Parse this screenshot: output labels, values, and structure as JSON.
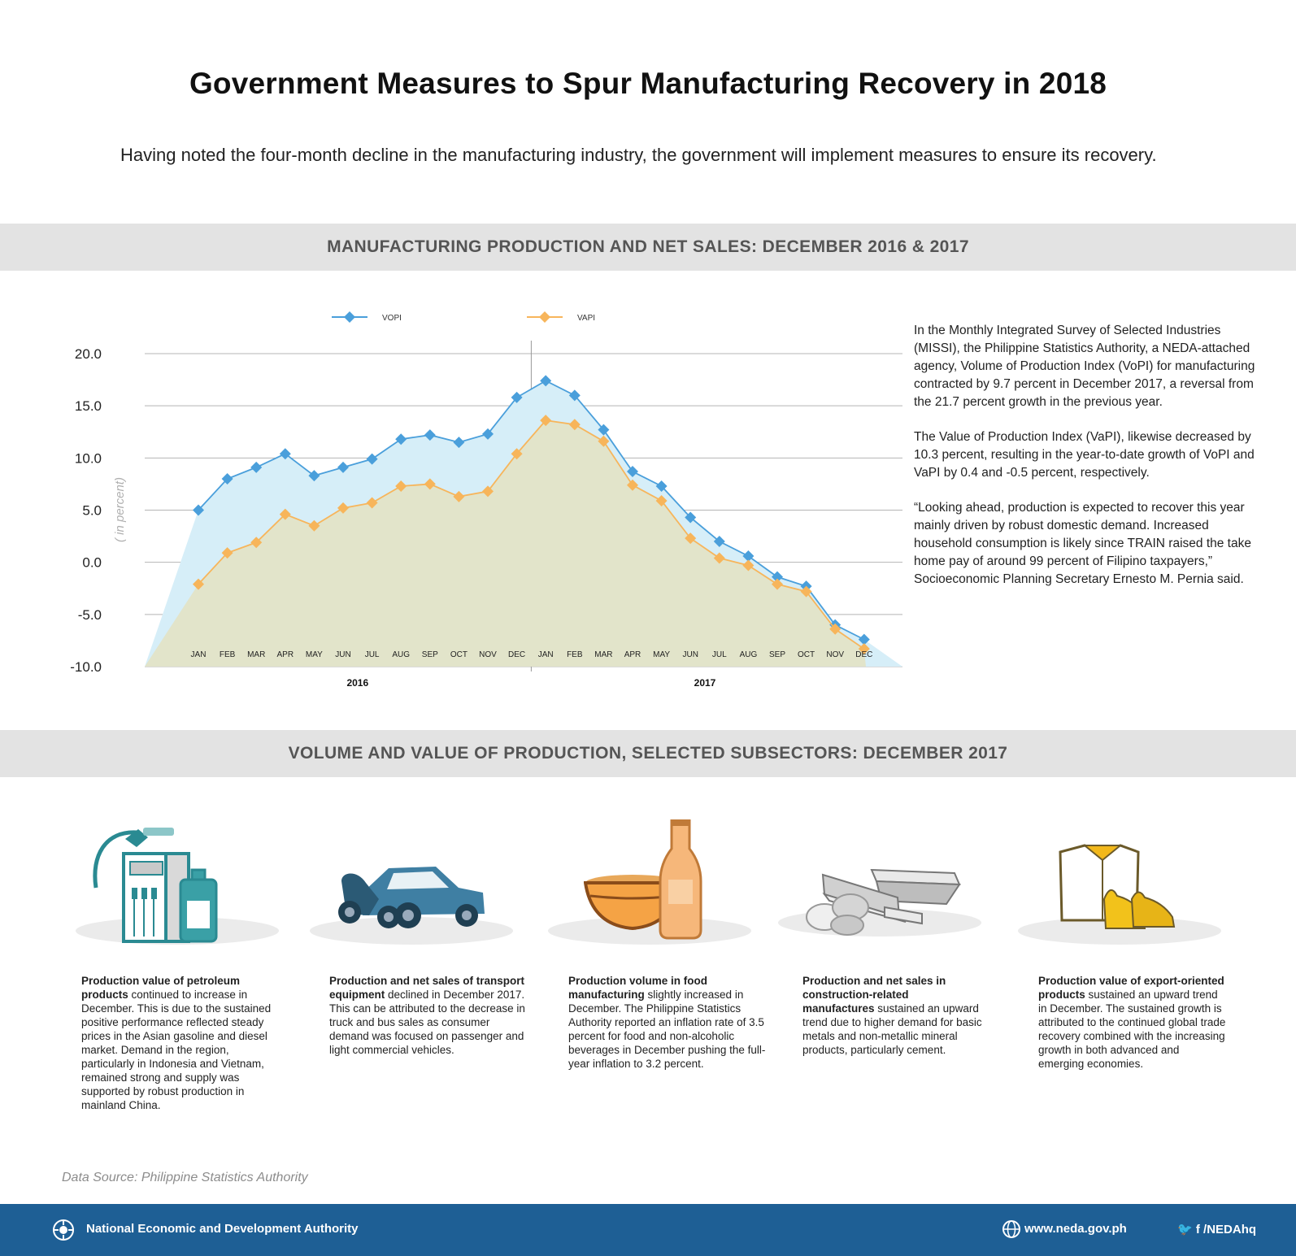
{
  "title": "Government Measures to Spur Manufacturing Recovery in 2018",
  "intro": "Having noted the four-month decline in the manufacturing industry, the government will implement measures to ensure its recovery.",
  "section1_title": "MANUFACTURING PRODUCTION AND NET SALES: DECEMBER 2016 & 2017",
  "section2_title": "VOLUME AND VALUE OF PRODUCTION, SELECTED SUBSECTORS: DECEMBER 2017",
  "chart_data": {
    "type": "area",
    "ylabel": "( in percent)",
    "ylim": [
      -10,
      20
    ],
    "yticks": [
      "20.0",
      "15.0",
      "10.0",
      "5.0",
      "0.0",
      "-5.0",
      "-10.0"
    ],
    "categories": [
      "JAN",
      "FEB",
      "MAR",
      "APR",
      "MAY",
      "JUN",
      "JUL",
      "AUG",
      "SEP",
      "OCT",
      "NOV",
      "DEC",
      "JAN",
      "FEB",
      "MAR",
      "APR",
      "MAY",
      "JUN",
      "JUL",
      "AUG",
      "SEP",
      "OCT",
      "NOV",
      "DEC"
    ],
    "year_groups": [
      "2016",
      "2017"
    ],
    "grid": true,
    "legend": "top",
    "series": [
      {
        "name": "VOPI",
        "color": "#4a9fdb",
        "fill": "#d6eef8",
        "values": [
          5.0,
          8.0,
          9.1,
          10.4,
          8.3,
          9.1,
          9.9,
          11.8,
          12.2,
          11.5,
          12.3,
          15.8,
          17.4,
          16.0,
          12.7,
          8.7,
          7.3,
          4.3,
          2.0,
          0.6,
          -1.4,
          -2.3,
          -6.0,
          -7.4
        ]
      },
      {
        "name": "VAPI",
        "color": "#f7b55b",
        "fill": "#e3e3c7",
        "values": [
          -2.1,
          0.9,
          1.9,
          4.6,
          3.5,
          5.2,
          5.7,
          7.3,
          7.5,
          6.3,
          6.8,
          10.4,
          13.6,
          13.2,
          11.6,
          7.4,
          5.9,
          2.3,
          0.4,
          -0.3,
          -2.1,
          -2.8,
          -6.4,
          -8.3
        ]
      }
    ]
  },
  "side_paragraphs": [
    "In the Monthly Integrated Survey of Selected Industries (MISSI), the Philippine Statistics Authority, a NEDA-attached agency, Volume of Production Index (VoPI) for manufacturing contracted by 9.7 percent in December 2017, a reversal from the 21.7 percent growth in the previous year.",
    "The Value of Production Index (VaPI), likewise decreased by 10.3 percent, resulting in the year-to-date growth of VoPI and VaPI by 0.4 and -0.5 percent, respectively.",
    "“Looking ahead, production is expected to recover this year mainly driven by robust domestic demand. Increased household consumption is likely since TRAIN raised the take home pay of around 99 percent of Filipino taxpayers,” Socioeconomic Planning Secretary Ernesto M. Pernia said."
  ],
  "subsectors": [
    {
      "icon": "fuel-pump-icon",
      "bold": "Production value of petroleum products",
      "text": " continued to increase in December. This is due to the sustained positive performance reflected steady prices in the Asian gasoline and diesel market. Demand in the region, particularly in Indonesia and Vietnam, remained strong and supply was supported by robust production in mainland China."
    },
    {
      "icon": "car-motorcycle-icon",
      "bold": "Production and net sales of transport equipment",
      "text": " declined in December 2017. This can be attributed to the decrease in truck and bus sales as consumer demand was focused on passenger and light commercial vehicles."
    },
    {
      "icon": "food-bowl-bottle-icon",
      "bold": "Production volume in food manufacturing",
      "text": " slightly increased in December. The Philippine Statistics Authority reported an inflation rate of 3.5 percent for food and non-alcoholic beverages in December pushing the full-year inflation to 3.2 percent."
    },
    {
      "icon": "steel-beams-rocks-icon",
      "bold": "Production and net sales in construction-related manufactures",
      "text": " sustained an upward trend due to higher demand for basic metals and non-metallic mineral products, particularly cement."
    },
    {
      "icon": "shirt-shoes-icon",
      "bold": "Production value of export-oriented products",
      "text": " sustained an upward trend in December. The sustained growth is attributed to the continued global trade recovery combined with the increasing growth in both advanced and emerging economies."
    }
  ],
  "source": "Data Source: Philippine Statistics Authority",
  "footer": {
    "org": "National Economic and Development Authority",
    "website": "www.neda.gov.ph",
    "social": "/NEDAhq"
  }
}
